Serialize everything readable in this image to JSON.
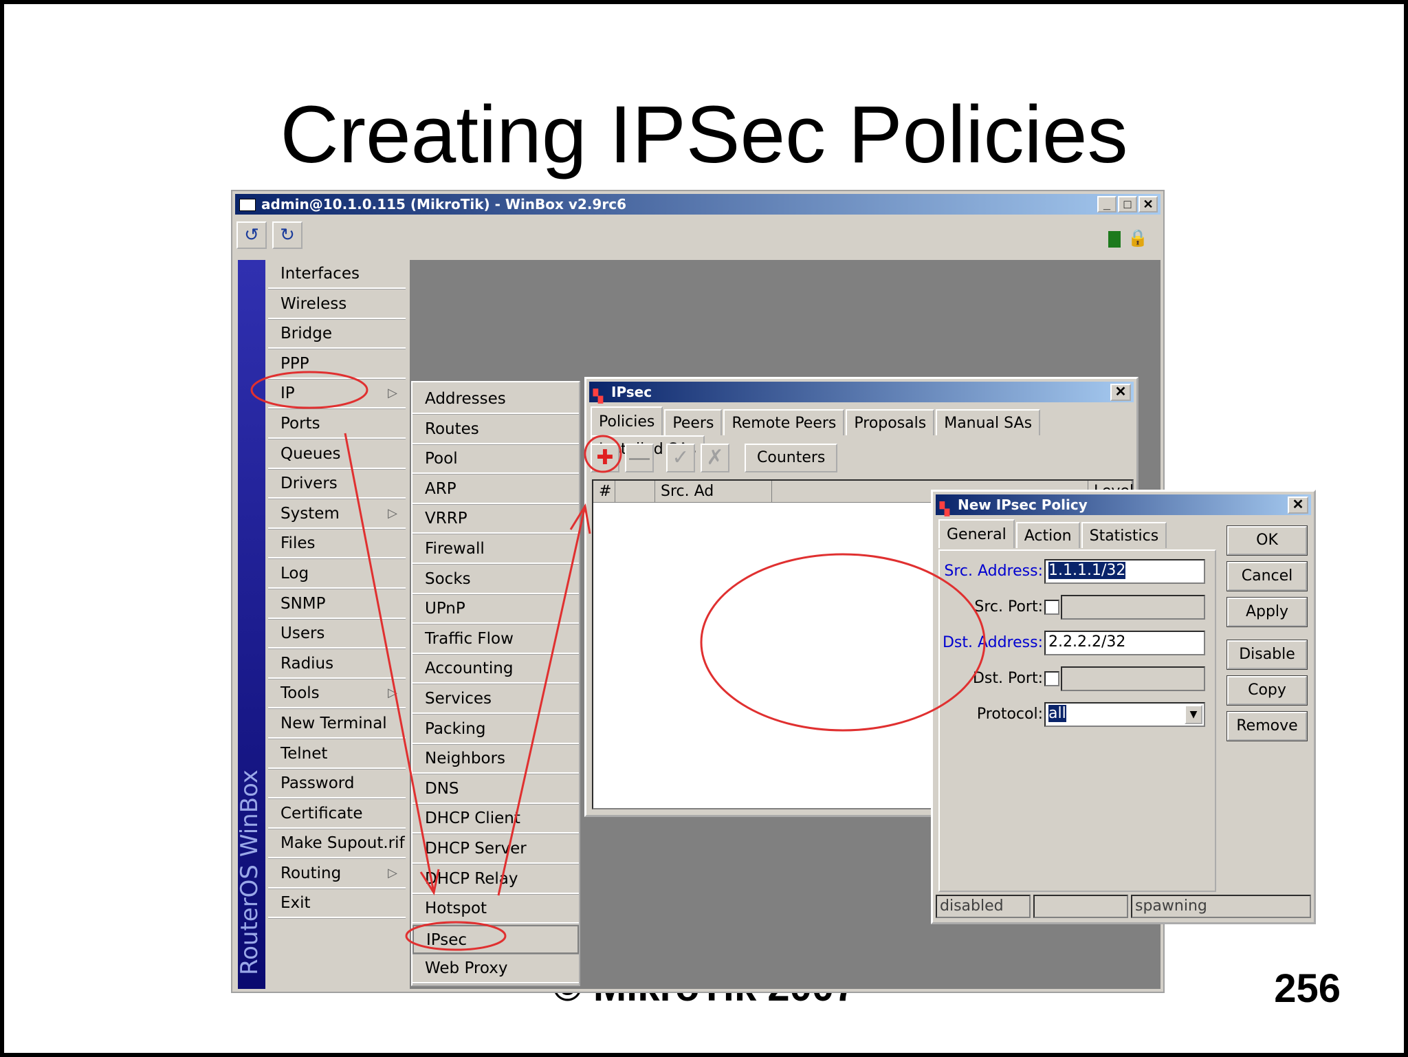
{
  "slide": {
    "title": "Creating IPSec Policies",
    "page_number": "256",
    "footer": "© MikroTik 2007"
  },
  "winbox": {
    "title": "admin@10.1.0.115 (MikroTik) - WinBox v2.9rc6",
    "side_label": "RouterOS WinBox",
    "minimize": "_",
    "maximize": "□",
    "close": "✕",
    "undo_icon": "↺",
    "redo_icon": "↻"
  },
  "main_menu": [
    {
      "label": "Interfaces"
    },
    {
      "label": "Wireless"
    },
    {
      "label": "Bridge"
    },
    {
      "label": "PPP"
    },
    {
      "label": "IP",
      "submenu": true
    },
    {
      "label": "Ports"
    },
    {
      "label": "Queues"
    },
    {
      "label": "Drivers"
    },
    {
      "label": "System",
      "submenu": true
    },
    {
      "label": "Files"
    },
    {
      "label": "Log"
    },
    {
      "label": "SNMP"
    },
    {
      "label": "Users"
    },
    {
      "label": "Radius"
    },
    {
      "label": "Tools",
      "submenu": true
    },
    {
      "label": "New Terminal"
    },
    {
      "label": "Telnet"
    },
    {
      "label": "Password"
    },
    {
      "label": "Certificate"
    },
    {
      "label": "Make Supout.rif"
    },
    {
      "label": "Routing",
      "submenu": true
    },
    {
      "label": "Exit"
    }
  ],
  "ip_submenu": [
    "Addresses",
    "Routes",
    "Pool",
    "ARP",
    "VRRP",
    "Firewall",
    "Socks",
    "UPnP",
    "Traffic Flow",
    "Accounting",
    "Services",
    "Packing",
    "Neighbors",
    "DNS",
    "DHCP Client",
    "DHCP Server",
    "DHCP Relay",
    "Hotspot",
    "IPsec",
    "Web Proxy"
  ],
  "ipsec_window": {
    "title": "IPsec",
    "tabs": [
      "Policies",
      "Peers",
      "Remote Peers",
      "Proposals",
      "Manual SAs",
      "Installed SAs"
    ],
    "add_icon": "✚",
    "remove_icon": "—",
    "enable_icon": "✓",
    "disable_icon": "✗",
    "counters_button": "Counters",
    "columns": [
      "#",
      "Src. Ad",
      "Level"
    ]
  },
  "policy_window": {
    "title": "New IPsec Policy",
    "tabs": [
      "General",
      "Action",
      "Statistics"
    ],
    "fields": {
      "src_address_label": "Src. Address:",
      "src_address_value": "1.1.1.1/32",
      "src_port_label": "Src. Port:",
      "dst_address_label": "Dst. Address:",
      "dst_address_value": "2.2.2.2/32",
      "dst_port_label": "Dst. Port:",
      "protocol_label": "Protocol:",
      "protocol_value": "all"
    },
    "buttons": [
      "OK",
      "Cancel",
      "Apply",
      "Disable",
      "Copy",
      "Remove"
    ],
    "status": [
      "disabled",
      "",
      "spawning"
    ]
  },
  "colors": {
    "annotation_red": "#e03030",
    "title_bar_start": "#0a246a",
    "title_bar_end": "#a6caf0",
    "window_face": "#d4d0c8"
  }
}
